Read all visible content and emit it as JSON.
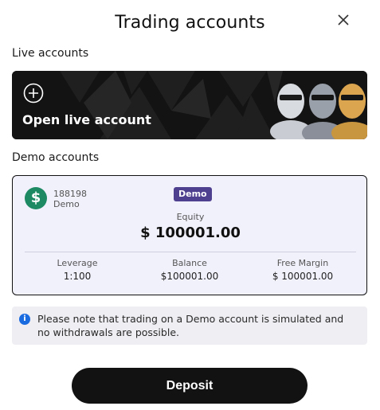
{
  "header": {
    "title": "Trading accounts"
  },
  "live": {
    "section_label": "Live accounts",
    "open_label": "Open live account"
  },
  "demo": {
    "section_label": "Demo accounts",
    "account_number": "188198",
    "account_type": "Demo",
    "badge": "Demo",
    "equity_label": "Equity",
    "equity_value": "$ 100001.00",
    "stats": [
      {
        "label": "Leverage",
        "value": "1:100"
      },
      {
        "label": "Balance",
        "value": "$100001.00"
      },
      {
        "label": "Free Margin",
        "value": "$ 100001.00"
      }
    ]
  },
  "notice": {
    "text": "Please note that trading on a Demo account is simulated and no withdrawals are possible."
  },
  "deposit_label": "Deposit",
  "colors": {
    "banner_bg": "#121212",
    "card_bg": "#f1f1fc",
    "badge_bg": "#4f3f8f",
    "dollar_green": "#1e8a63",
    "info_blue": "#1a6ae0"
  }
}
